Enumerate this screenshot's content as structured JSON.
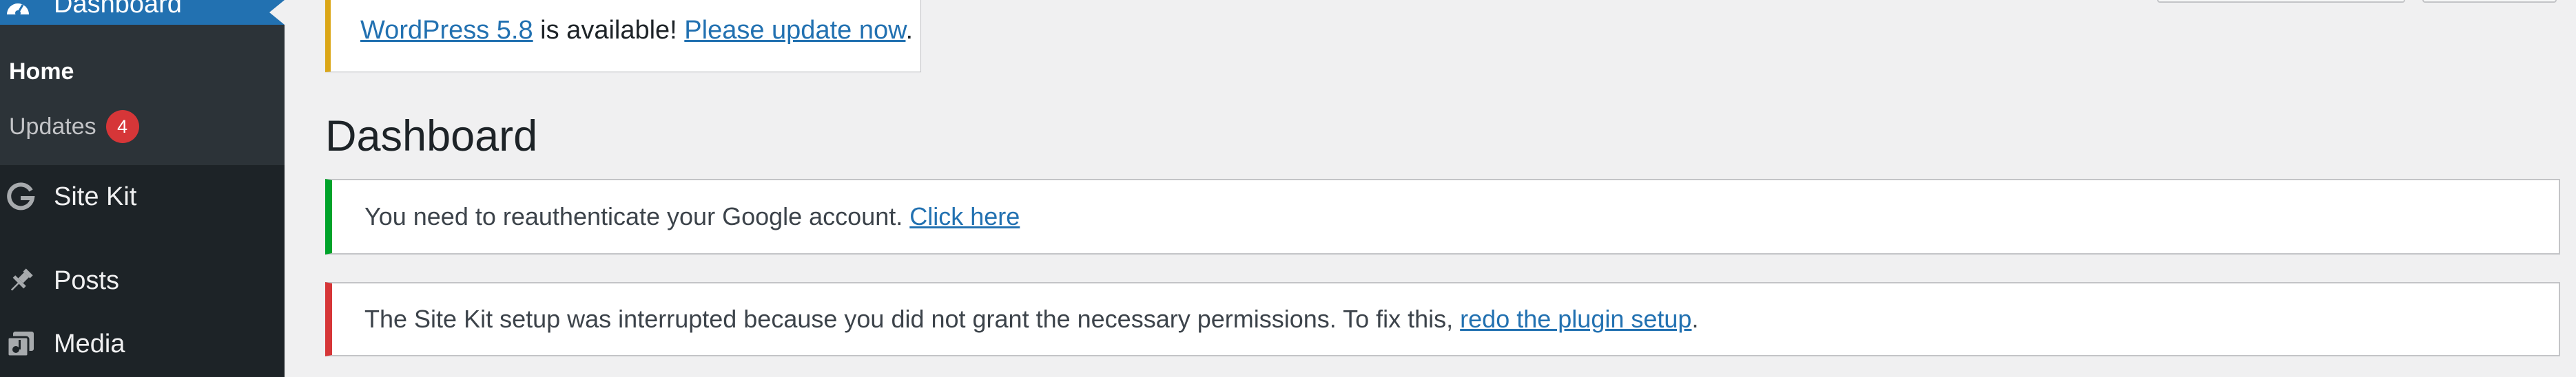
{
  "sidebar": {
    "dashboard": {
      "label": "Dashboard",
      "icon": "dashboard-icon"
    },
    "submenu": {
      "home": "Home",
      "updates": {
        "label": "Updates",
        "badge": "4"
      }
    },
    "items": [
      {
        "label": "Site Kit",
        "icon": "google-g-icon"
      },
      {
        "label": "Posts",
        "icon": "pushpin-icon"
      },
      {
        "label": "Media",
        "icon": "media-icon"
      }
    ]
  },
  "update_nag": {
    "version_link": "WordPress 5.8",
    "text": " is available! ",
    "update_link": "Please update now",
    "end": "."
  },
  "page_title": "Dashboard",
  "notices": {
    "reauth": {
      "text": "You need to reauthenticate your Google account. ",
      "link": "Click here"
    },
    "interrupted": {
      "text": "The Site Kit setup was interrupted because you did not grant the necessary permissions. To fix this, ",
      "link": "redo the plugin setup",
      "end": "."
    }
  },
  "colors": {
    "sidebar_bg": "#1d2327",
    "submenu_bg": "#2c3338",
    "accent": "#2271b1",
    "warning": "#dba617",
    "success": "#00a32a",
    "error": "#d63638"
  }
}
